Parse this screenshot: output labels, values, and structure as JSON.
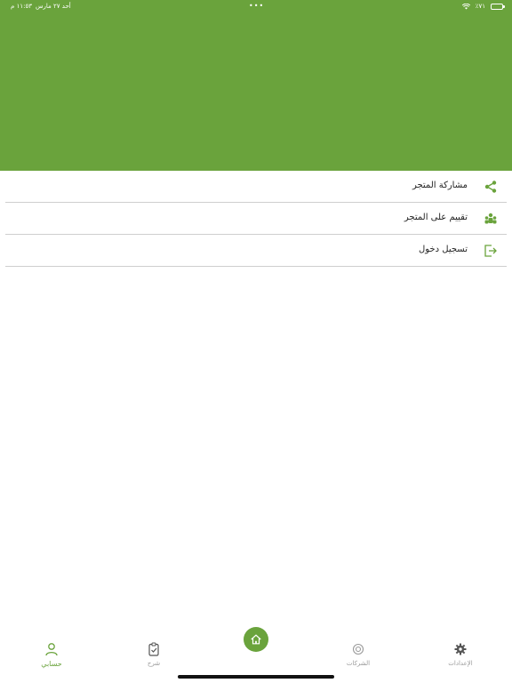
{
  "status_bar": {
    "date": "أحد ٢٧ مارس",
    "time": "١١:٥٣ م",
    "battery": "٧١٪",
    "dots": "•••"
  },
  "colors": {
    "brand": "#6aa33c",
    "divider": "#cfcfcf"
  },
  "menu": {
    "items": [
      {
        "label": "مشاركة المتجر",
        "icon": "share-icon"
      },
      {
        "label": "تقييم على المتجر",
        "icon": "group-icon"
      },
      {
        "label": "تسجيل دخول",
        "icon": "login-icon"
      }
    ]
  },
  "tabbar": {
    "settings": "الإعدادات",
    "companies": "الشركات",
    "home": "home-icon",
    "orders": "شرح",
    "account": "حسابي"
  }
}
